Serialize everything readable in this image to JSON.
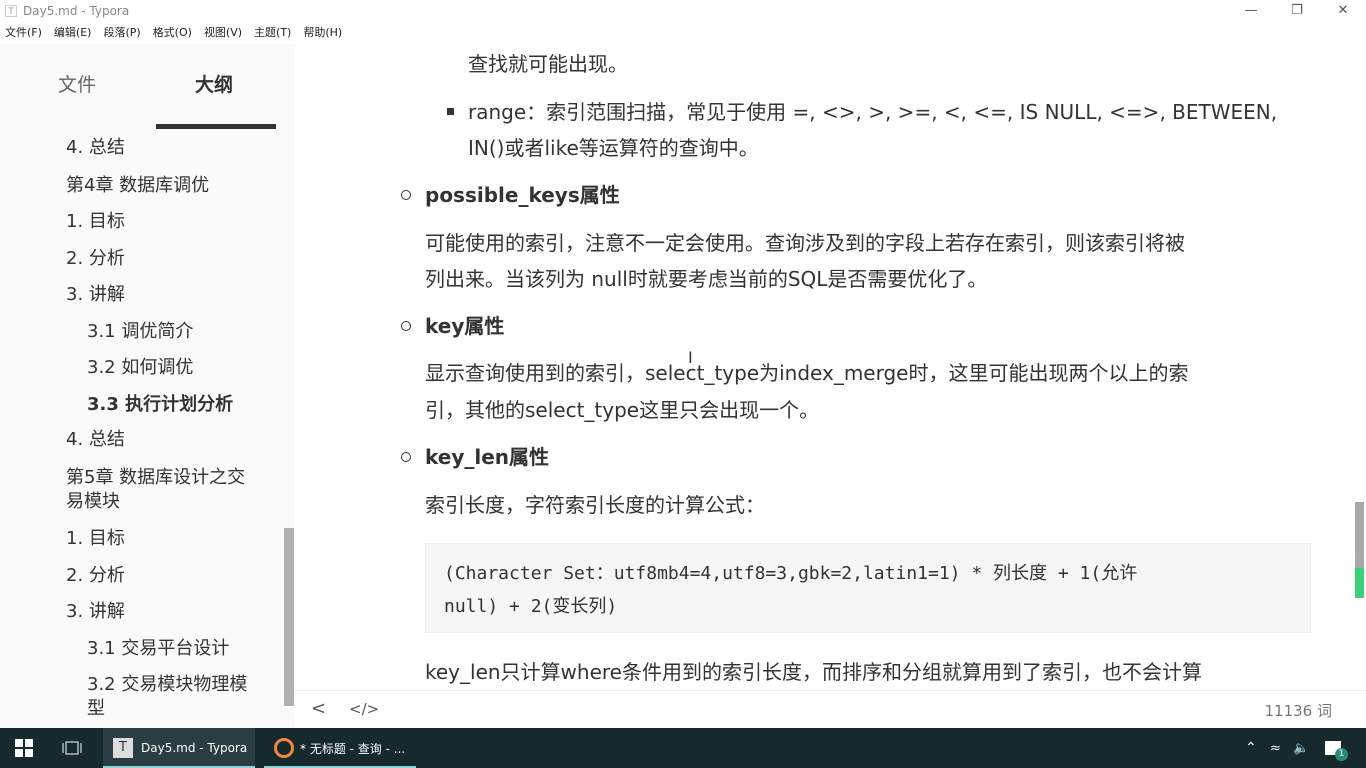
{
  "window": {
    "title": "Day5.md - Typora",
    "app_icon": "T",
    "controls": [
      "minimize",
      "restore",
      "close"
    ]
  },
  "menu": [
    "文件(F)",
    "编辑(E)",
    "段落(P)",
    "格式(O)",
    "视图(V)",
    "主题(T)",
    "帮助(H)"
  ],
  "sidebar": {
    "tabs": [
      {
        "label": "文件",
        "active": false
      },
      {
        "label": "大纲",
        "active": true
      }
    ],
    "outline": [
      {
        "label": "4. 总结",
        "level": 1
      },
      {
        "label": "第4章 数据库调优",
        "level": 1
      },
      {
        "label": "1. 目标",
        "level": 1
      },
      {
        "label": "2. 分析",
        "level": 1
      },
      {
        "label": "3. 讲解",
        "level": 1
      },
      {
        "label": "3.1 调优简介",
        "level": 2
      },
      {
        "label": "3.2 如何调优",
        "level": 2
      },
      {
        "label": "3.3 执行计划分析",
        "level": 2,
        "active": true
      },
      {
        "label": "4. 总结",
        "level": 1
      },
      {
        "label": "第5章 数据库设计之交易模块",
        "level": 1
      },
      {
        "label": "1. 目标",
        "level": 1
      },
      {
        "label": "2. 分析",
        "level": 1
      },
      {
        "label": "3. 讲解",
        "level": 1
      },
      {
        "label": "3.1 交易平台设计",
        "level": 2
      },
      {
        "label": "3.2 交易模块物理模型",
        "level": 2
      }
    ]
  },
  "editor": {
    "line0": "查找就可能出现。",
    "range1": "range：索引范围扫描，常见于使用 =, <>, >, >=, <, <=, IS NULL, <=>, BETWEEN,",
    "range2": "IN()或者like等运算符的查询中。",
    "pk_heading": "possible_keys属性",
    "pk1": "可能使用的索引，注意不一定会使用。查询涉及到的字段上若存在索引，则该索引将被",
    "pk2": "列出来。当该列为 null时就要考虑当前的SQL是否需要优化了。",
    "key_heading": "key属性",
    "key1": "显示查询使用到的索引，select_type为index_merge时，这里可能出现两个以上的索",
    "key2": "引，其他的select_type这里只会出现一个。",
    "kl_heading": "key_len属性",
    "kl1": "索引长度，字符索引长度的计算公式：",
    "code1": "(Character Set：utf8mb4=4,utf8=3,gbk=2,latin1=1) * 列长度 + 1(允许",
    "code2": "null) + 2(变长列)",
    "kl2": "key_len只计算where条件用到的索引长度，而排序和分组就算用到了索引，也不会计算"
  },
  "footer": {
    "back_icon": "<",
    "source_icon": "</>",
    "word_count": "11136 词"
  },
  "taskbar": {
    "apps": [
      {
        "label": "Day5.md - Typora",
        "icon": "T"
      },
      {
        "label": "* 无标题 - 查询 - ..."
      }
    ],
    "notification_count": "1"
  }
}
